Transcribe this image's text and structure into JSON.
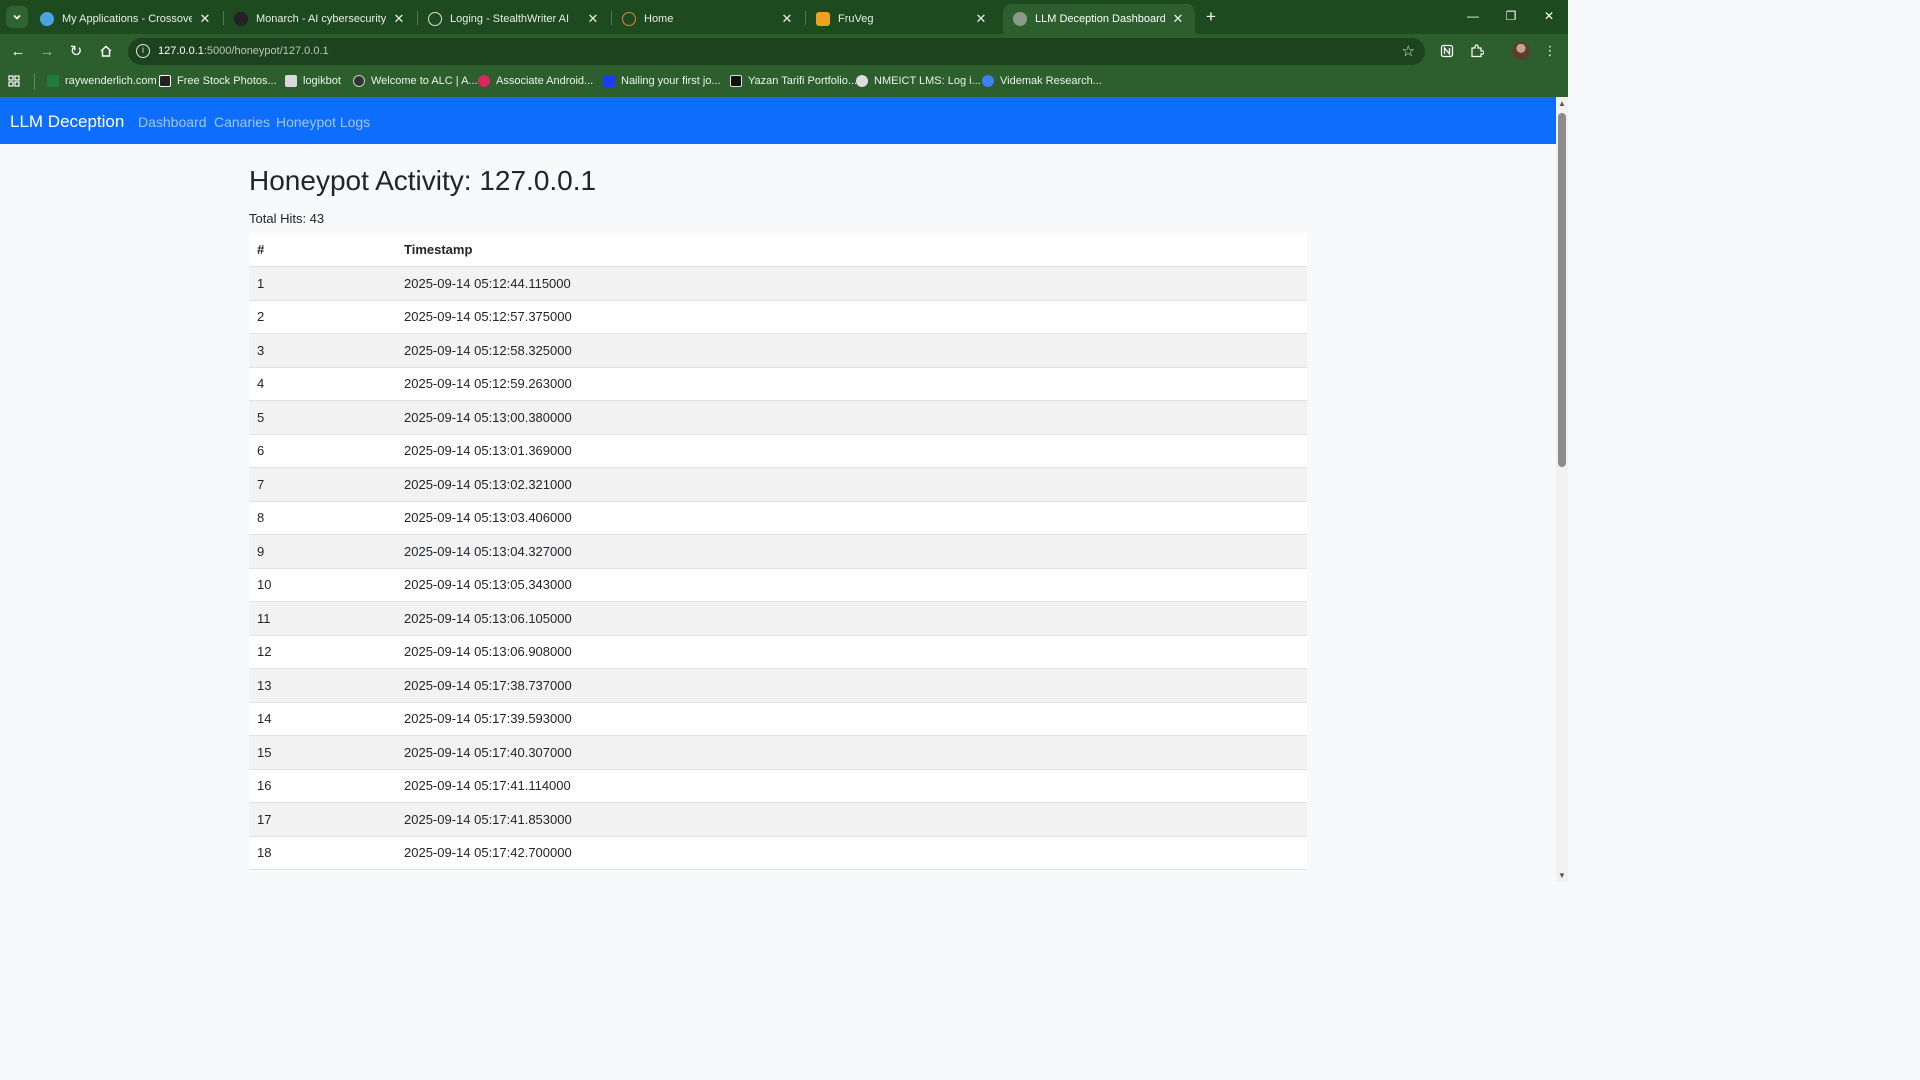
{
  "browser": {
    "tabs": [
      {
        "title": "My Applications - Crossover",
        "favicon_color": "#4aa3df"
      },
      {
        "title": "Monarch - AI cybersecurity proj",
        "favicon_color": "#222222"
      },
      {
        "title": "Loging - StealthWriter AI",
        "favicon_color": "#111111"
      },
      {
        "title": "Home",
        "favicon_color": "#b5651d"
      },
      {
        "title": "FruVeg",
        "favicon_color": "#f0a020"
      },
      {
        "title": "LLM Deception Dashboard",
        "favicon_color": "#8a9a8a"
      }
    ],
    "active_tab_index": 5,
    "url_host": "127.0.0.1",
    "url_rest": ":5000/honeypot/127.0.0.1",
    "bookmarks": [
      {
        "label": "raywenderlich.com",
        "color": "#1e7d3c"
      },
      {
        "label": "Free Stock Photos...",
        "color": "#222222"
      },
      {
        "label": "logikbot",
        "color": "#d9d9d9"
      },
      {
        "label": "Welcome to ALC | A...",
        "color": "#333333"
      },
      {
        "label": "Associate Android...",
        "color": "#e0245e"
      },
      {
        "label": "Nailing your first jo...",
        "color": "#1a3cff"
      },
      {
        "label": "Yazan Tarifi Portfolio...",
        "color": "#111111"
      },
      {
        "label": "NMEICT LMS: Log i...",
        "color": "#dddddd"
      },
      {
        "label": "Videmak Research...",
        "color": "#3b82f6"
      }
    ]
  },
  "app": {
    "brand": "LLM Deception",
    "nav": [
      "Dashboard",
      "Canaries",
      "Honeypot Logs"
    ],
    "accent": "#0d6efd"
  },
  "page": {
    "title": "Honeypot Activity: 127.0.0.1",
    "total_hits": "Total Hits: 43",
    "table": {
      "headers": [
        "#",
        "Timestamp"
      ],
      "rows": [
        [
          "1",
          "2025-09-14 05:12:44.115000"
        ],
        [
          "2",
          "2025-09-14 05:12:57.375000"
        ],
        [
          "3",
          "2025-09-14 05:12:58.325000"
        ],
        [
          "4",
          "2025-09-14 05:12:59.263000"
        ],
        [
          "5",
          "2025-09-14 05:13:00.380000"
        ],
        [
          "6",
          "2025-09-14 05:13:01.369000"
        ],
        [
          "7",
          "2025-09-14 05:13:02.321000"
        ],
        [
          "8",
          "2025-09-14 05:13:03.406000"
        ],
        [
          "9",
          "2025-09-14 05:13:04.327000"
        ],
        [
          "10",
          "2025-09-14 05:13:05.343000"
        ],
        [
          "11",
          "2025-09-14 05:13:06.105000"
        ],
        [
          "12",
          "2025-09-14 05:13:06.908000"
        ],
        [
          "13",
          "2025-09-14 05:17:38.737000"
        ],
        [
          "14",
          "2025-09-14 05:17:39.593000"
        ],
        [
          "15",
          "2025-09-14 05:17:40.307000"
        ],
        [
          "16",
          "2025-09-14 05:17:41.114000"
        ],
        [
          "17",
          "2025-09-14 05:17:41.853000"
        ],
        [
          "18",
          "2025-09-14 05:17:42.700000"
        ]
      ]
    }
  }
}
